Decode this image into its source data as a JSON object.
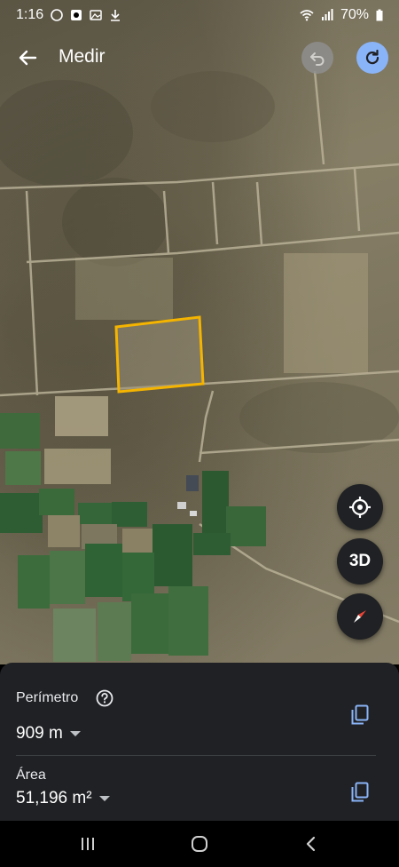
{
  "status_bar": {
    "time": "1:16",
    "battery": "70%"
  },
  "header": {
    "title": "Medir"
  },
  "map": {
    "polygon_color": "#f4b400",
    "fab_3d_label": "3D"
  },
  "measure": {
    "perimeter_label": "Perímetro",
    "perimeter_value": "909 m",
    "area_label": "Área",
    "area_value": "51,196 m²"
  },
  "colors": {
    "accent": "#8ab4f8",
    "sheet_bg": "#202124"
  }
}
